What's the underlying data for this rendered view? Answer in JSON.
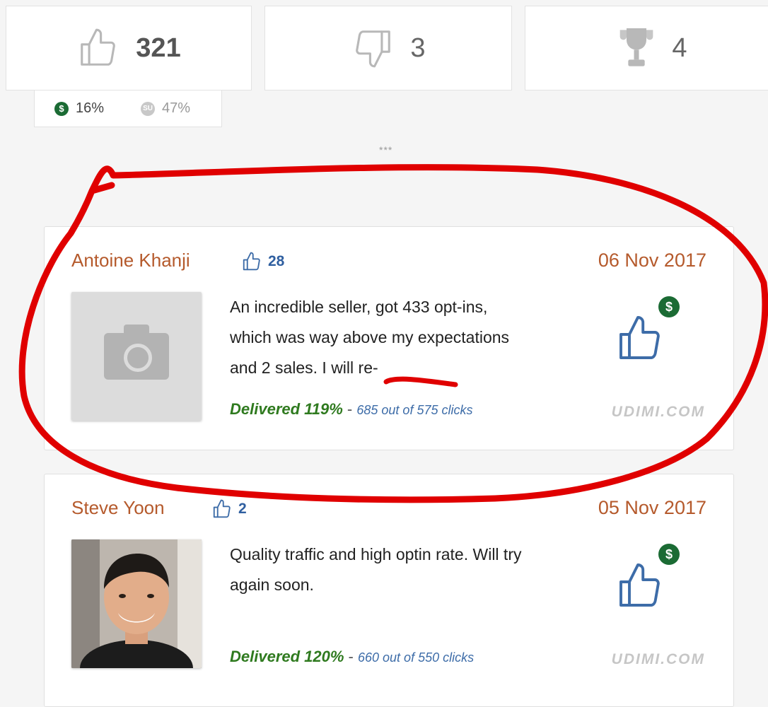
{
  "stats": {
    "positive": "321",
    "negative": "3",
    "trophy": "4"
  },
  "percentages": {
    "money_badge": "$",
    "money_pct": "16%",
    "su_badge": "SU",
    "su_pct": "47%"
  },
  "separator": "***",
  "reviews": [
    {
      "name": "Antoine Khanji",
      "likes": "28",
      "date": "06 Nov 2017",
      "text": "An incredible seller, got 433 opt-ins, which was way above my expectations and 2 sales. I will re-",
      "delivered": "Delivered 119%",
      "dash": " - ",
      "clicks": "685 out of 575 clicks",
      "badge": "$",
      "brand": "UDIMI.COM"
    },
    {
      "name": "Steve Yoon",
      "likes": "2",
      "date": "05 Nov 2017",
      "text": "Quality traffic and high optin rate. Will try again soon.",
      "delivered": "Delivered 120%",
      "dash": " - ",
      "clicks": "660 out of 550 clicks",
      "badge": "$",
      "brand": "UDIMI.COM"
    }
  ],
  "icons": {
    "like": "thumbs-up-icon",
    "dislike": "thumbs-down-icon",
    "trophy": "trophy-icon",
    "camera": "camera-icon"
  },
  "colors": {
    "name": "#b55a2c",
    "delivered": "#2f7a1f",
    "clicks": "#3d6ca8",
    "money_badge": "#1b6b34",
    "annotation": "#e00000"
  }
}
